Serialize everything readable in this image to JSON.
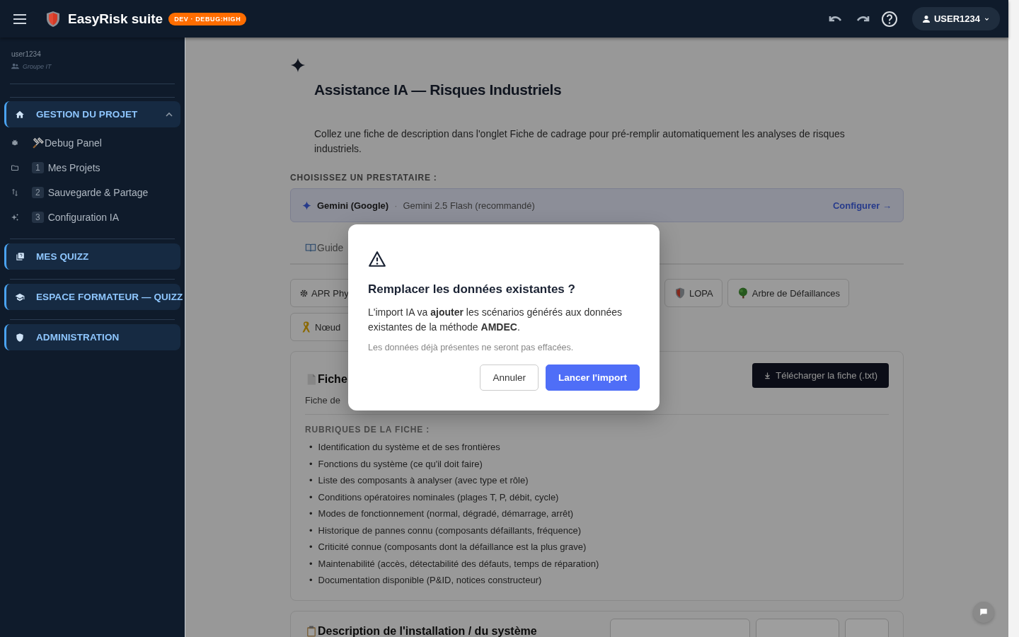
{
  "app": {
    "title": "EasyRisk suite",
    "env_badge": "DEV · DEBUG:HIGH",
    "user_button": "USER1234"
  },
  "sidebar": {
    "user": "user1234",
    "group": "Groupe IT",
    "sections": [
      {
        "label": "GESTION DU PROJET",
        "expanded": true,
        "items": [
          {
            "kind": "tool",
            "label": "Debug Panel"
          },
          {
            "kind": "numbered",
            "number": "1",
            "label": "Mes Projets"
          },
          {
            "kind": "numbered",
            "number": "2",
            "label": "Sauvegarde & Partage"
          },
          {
            "kind": "numbered",
            "number": "3",
            "label": "Configuration IA"
          }
        ]
      },
      {
        "label": "MES QUIZZ",
        "expanded": false
      },
      {
        "label": "ESPACE FORMATEUR — QUIZZ",
        "expanded": false
      },
      {
        "label": "ADMINISTRATION",
        "expanded": false
      }
    ]
  },
  "page": {
    "title": "Assistance IA — Risques Industriels",
    "intro": "Collez une fiche de description dans l'onglet Fiche de cadrage pour pré-remplir automatiquement les analyses de risques industriels.",
    "provider_label": "CHOISISSEZ UN PRESTATAIRE :",
    "provider": {
      "name": "Gemini (Google)",
      "separator": "·",
      "model": "Gemini 2.5 Flash (recommandé)",
      "action": "Configurer →"
    },
    "tabs": [
      {
        "label": "Guide",
        "selected": false
      }
    ],
    "methods": [
      {
        "label": "APR Phy",
        "kind": "wide"
      },
      {
        "label": "LOPA",
        "kind": "normal"
      },
      {
        "label": "Arbre de Défaillances",
        "kind": "normal"
      },
      {
        "label": "Nœud",
        "kind": "wide"
      }
    ],
    "fiche": {
      "title": "Fiche",
      "description": "Fiche de",
      "download": "Télécharger la fiche (.txt)",
      "sections_label": "RUBRIQUES DE LA FICHE :",
      "bullet": "•",
      "items": [
        "Identification du système et de ses frontières",
        "Fonctions du système (ce qu'il doit faire)",
        "Liste des composants à analyser (avec type et rôle)",
        "Conditions opératoires nominales (plages T, P, débit, cycle)",
        "Modes de fonctionnement (normal, dégradé, démarrage, arrêt)",
        "Historique de pannes connu (composants défaillants, fréquence)",
        "Criticité connue (composants dont la défaillance est la plus grave)",
        "Maintenabilité (accès, détectabilité des défauts, temps de réparation)",
        "Documentation disponible (P&ID, notices constructeur)"
      ]
    },
    "next_card": {
      "title": "Description de l'installation / du système"
    }
  },
  "dialog": {
    "title": "Remplacer les données existantes ?",
    "message": "L'import IA va **ajouter** les scénarios générés aux données existantes de la méthode **AMDEC**.",
    "note": "Les données déjà présentes ne seront pas effacées.",
    "buttons": [
      {
        "label": "Annuler",
        "kind": "secondary"
      },
      {
        "label": "Lancer l'import",
        "kind": "primary"
      }
    ]
  }
}
